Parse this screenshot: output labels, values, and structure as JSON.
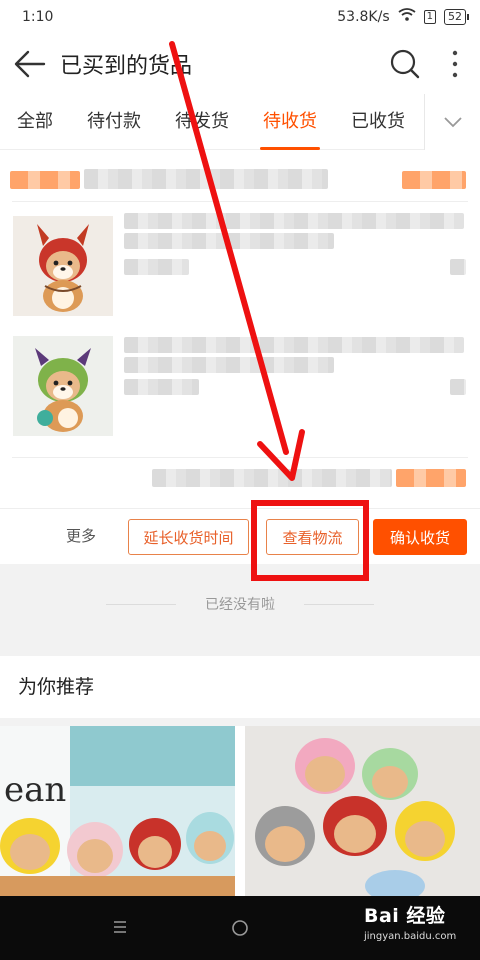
{
  "status": {
    "time": "1:10",
    "speed": "53.8K/s",
    "battery": "52"
  },
  "nav": {
    "title": "已买到的货品"
  },
  "tabs": [
    "全部",
    "待付款",
    "待发货",
    "待收货",
    "已收货"
  ],
  "active_tab_index": 3,
  "order": {
    "items": [
      {
        "image": "plush-shiba-red-dragon-hat"
      },
      {
        "image": "plush-shiba-green-monster-hat"
      }
    ],
    "actions": {
      "more": "更多",
      "extend": "延长收货时间",
      "logistics": "查看物流",
      "confirm": "确认收货"
    }
  },
  "end_text": "已经没有啦",
  "recommend": {
    "title": "为你推荐"
  },
  "watermark": {
    "brand": "Bai 经验",
    "url": "jingyan.baidu.com"
  },
  "colors": {
    "accent": "#ff5000",
    "highlight": "#ee1111"
  }
}
